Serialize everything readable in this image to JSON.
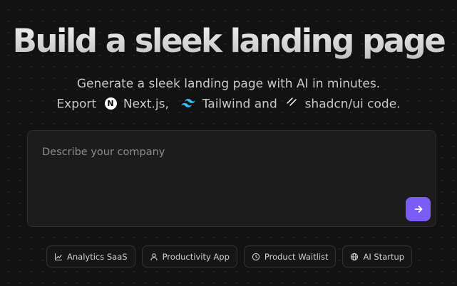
{
  "hero": {
    "title": "Build a sleek landing page",
    "subtitle_line1": "Generate a sleek landing page with AI in minutes.",
    "export_label": "Export",
    "nextjs_label": "Next.js,",
    "tailwind_label": "Tailwind",
    "and_label": "and",
    "shadcn_label": "shadcn/ui code."
  },
  "prompt": {
    "placeholder": "Describe your company",
    "value": "",
    "submit_icon": "arrow-right-icon",
    "accent_color": "#7b5cf4"
  },
  "suggestions": [
    {
      "label": "Analytics SaaS",
      "icon": "chart-line-icon"
    },
    {
      "label": "Productivity App",
      "icon": "user-icon"
    },
    {
      "label": "Product Waitlist",
      "icon": "clock-icon"
    },
    {
      "label": "AI Startup",
      "icon": "globe-icon"
    }
  ]
}
